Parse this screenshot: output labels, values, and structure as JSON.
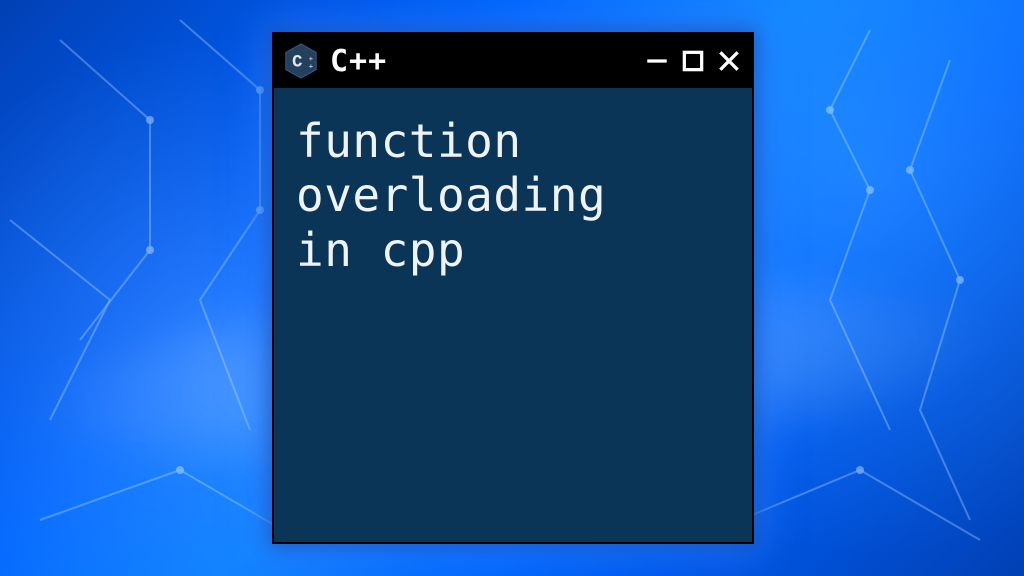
{
  "window": {
    "title": "C++",
    "icon_letter": "C",
    "body_text": "function\noverloading\nin cpp"
  },
  "controls": {
    "minimize_label": "Minimize",
    "maximize_label": "Maximize",
    "close_label": "Close"
  },
  "colors": {
    "window_bg": "#0b3557",
    "titlebar_bg": "#000000",
    "text": "#eef3f7",
    "badge_fill": "#23405f",
    "badge_letter": "#dfe9f3"
  }
}
